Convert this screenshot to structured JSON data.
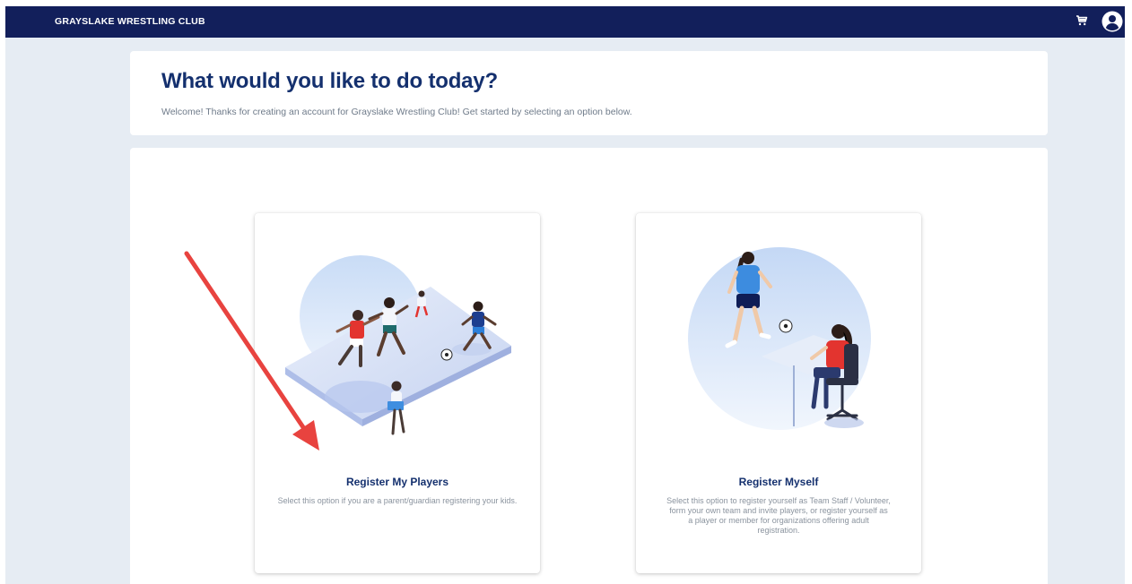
{
  "topbar": {
    "brand": "GRAYSLAKE WRESTLING CLUB",
    "cart_icon": "cart-icon",
    "account_icon": "account-circle-icon",
    "background": "#121f5b"
  },
  "welcome": {
    "title": "What would you like to do today?",
    "subtitle": "Welcome! Thanks for creating an account for Grayslake Wrestling Club! Get started by selecting an option below."
  },
  "options": [
    {
      "title": "Register My Players",
      "description": "Select this option if you are a parent/guardian registering your kids."
    },
    {
      "title": "Register Myself",
      "description": "Select this option to register yourself as Team Staff / Volunteer, form your own team and invite players, or register yourself as a player or member for organizations offering adult registration."
    }
  ],
  "colors": {
    "page_bg": "#e6ecf3",
    "title": "#14306e",
    "muted_text": "#8a939e",
    "annotation_arrow": "#e8433f"
  }
}
